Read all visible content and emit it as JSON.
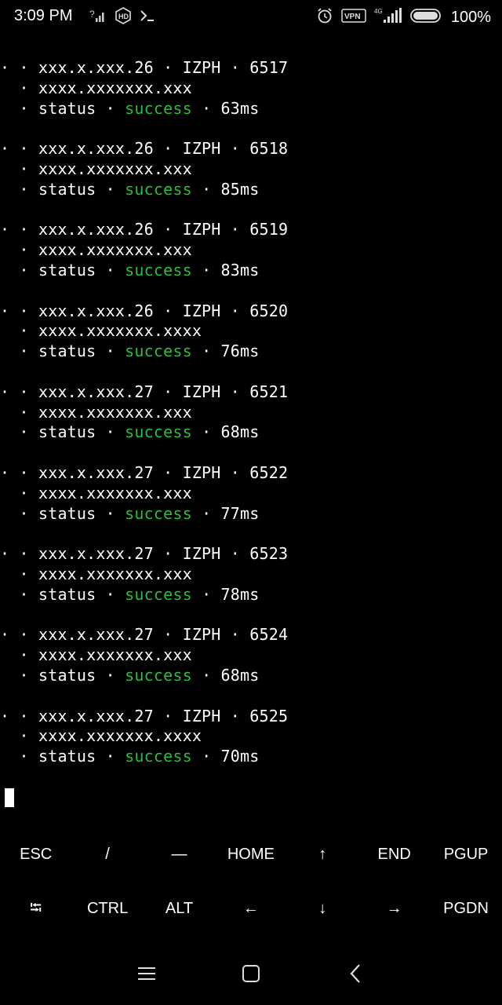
{
  "statusbar": {
    "time": "3:09 PM",
    "battery_percent": "100%",
    "icons_left": [
      "signal-question-icon",
      "hd-icon",
      "terminal-prompt-icon"
    ],
    "icons_right": [
      "alarm-icon",
      "vpn-icon",
      "4g-signal-icon",
      "battery-icon"
    ]
  },
  "terminal": {
    "entries": [
      {
        "l1": "· · xxx.x.xxx.26 · IZPH · 6517",
        "l2": "  · xxxx.xxxxxxx.xxx",
        "pre": "  · status · ",
        "status": "success",
        "post": " · 63ms"
      },
      {
        "l1": "· · xxx.x.xxx.26 · IZPH · 6518",
        "l2": "  · xxxx.xxxxxxx.xxx",
        "pre": "  · status · ",
        "status": "success",
        "post": " · 85ms"
      },
      {
        "l1": "· · xxx.x.xxx.26 · IZPH · 6519",
        "l2": "  · xxxx.xxxxxxx.xxx",
        "pre": "  · status · ",
        "status": "success",
        "post": " · 83ms"
      },
      {
        "l1": "· · xxx.x.xxx.26 · IZPH · 6520",
        "l2": "  · xxxx.xxxxxxx.xxxx",
        "pre": "  · status · ",
        "status": "success",
        "post": " · 76ms"
      },
      {
        "l1": "· · xxx.x.xxx.27 · IZPH · 6521",
        "l2": "  · xxxx.xxxxxxx.xxx",
        "pre": "  · status · ",
        "status": "success",
        "post": " · 68ms"
      },
      {
        "l1": "· · xxx.x.xxx.27 · IZPH · 6522",
        "l2": "  · xxxx.xxxxxxx.xxx",
        "pre": "  · status · ",
        "status": "success",
        "post": " · 77ms"
      },
      {
        "l1": "· · xxx.x.xxx.27 · IZPH · 6523",
        "l2": "  · xxxx.xxxxxxx.xxx",
        "pre": "  · status · ",
        "status": "success",
        "post": " · 78ms"
      },
      {
        "l1": "· · xxx.x.xxx.27 · IZPH · 6524",
        "l2": "  · xxxx.xxxxxxx.xxx",
        "pre": "  · status · ",
        "status": "success",
        "post": " · 68ms"
      },
      {
        "l1": "· · xxx.x.xxx.27 · IZPH · 6525",
        "l2": "  · xxxx.xxxxxxx.xxxx",
        "pre": "  · status · ",
        "status": "success",
        "post": " · 70ms"
      }
    ],
    "success_color": "#2bbd3b"
  },
  "extra_keys": {
    "row1": [
      "ESC",
      "/",
      "—",
      "HOME",
      "↑",
      "END",
      "PGUP"
    ],
    "row2": [
      "⭾",
      "CTRL",
      "ALT",
      "←",
      "↓",
      "→",
      "PGDN"
    ]
  },
  "navbar": {
    "icons": [
      "menu-icon",
      "home-square-icon",
      "back-icon"
    ]
  }
}
